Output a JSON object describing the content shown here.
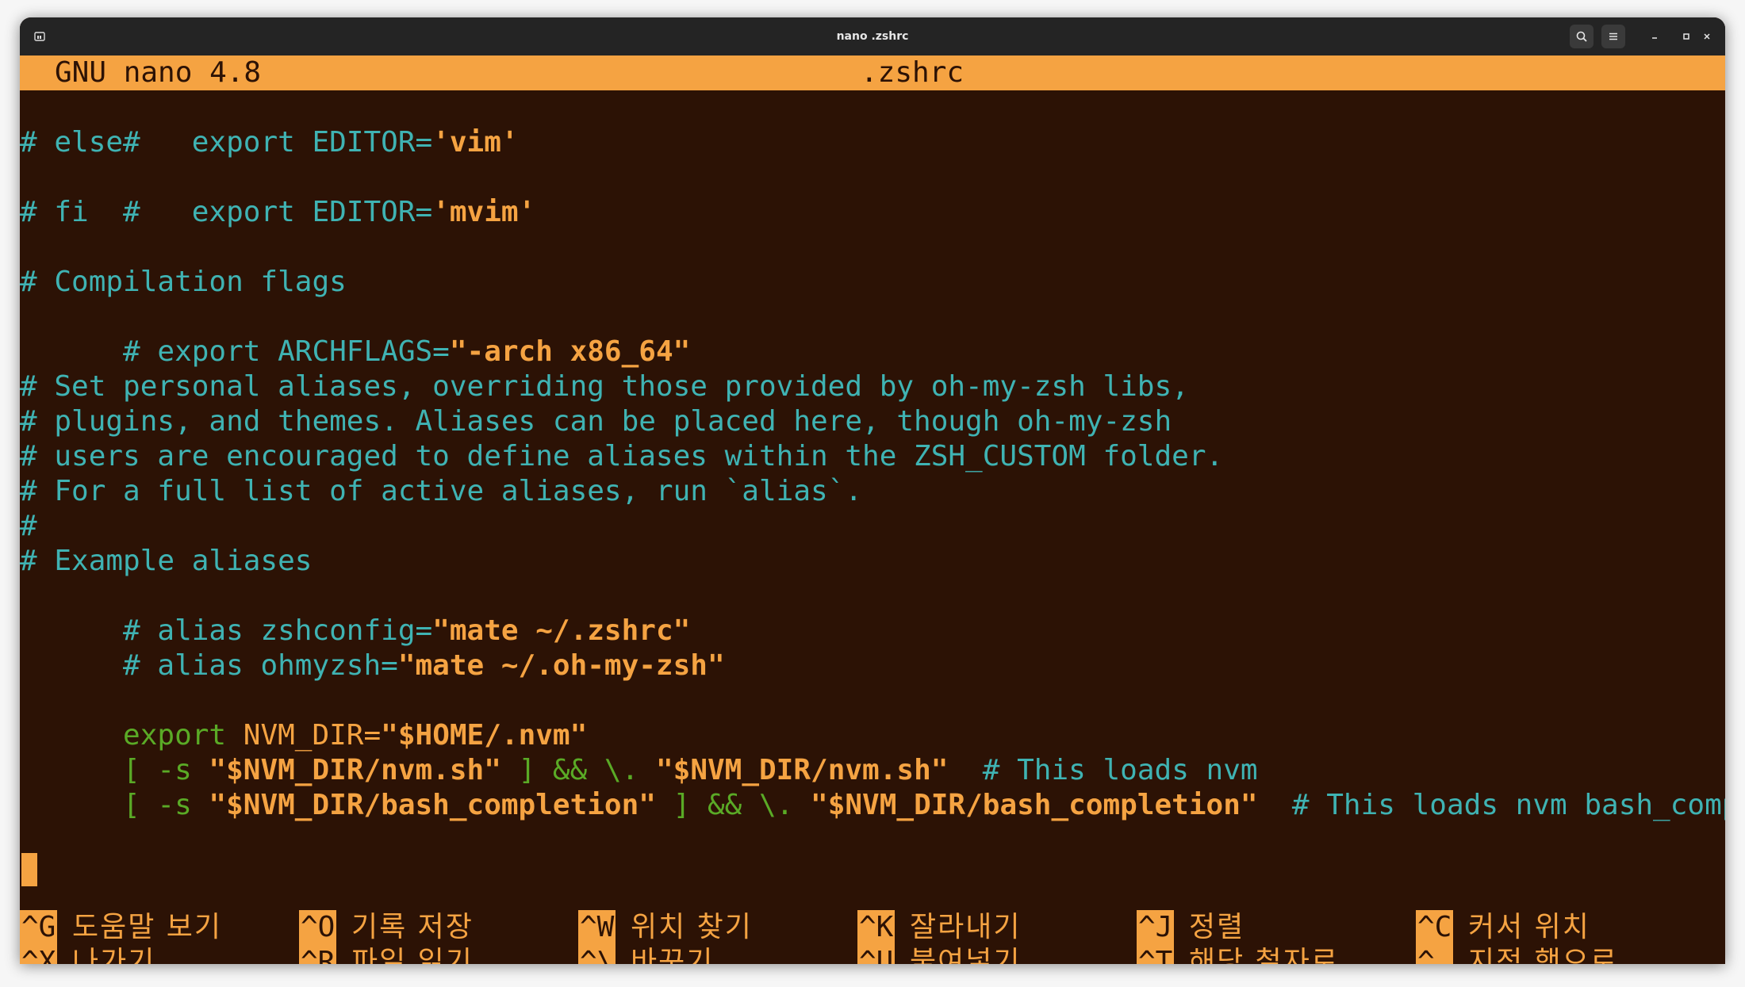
{
  "window": {
    "title": "nano .zshrc",
    "pin_icon": "terminal-pin-icon",
    "search_icon": "search-icon",
    "menu_icon": "hamburger-menu-icon",
    "minimize_icon": "minimize-icon",
    "maximize_icon": "maximize-icon",
    "close_icon": "close-icon"
  },
  "nano": {
    "version": "GNU nano 4.8",
    "filename": ".zshrc"
  },
  "lines": {
    "l1": {
      "prefix": "#   export EDITOR=",
      "str": "'vim'"
    },
    "l2": {
      "text": "# else"
    },
    "l3": {
      "prefix": "#   export EDITOR=",
      "str": "'mvim'"
    },
    "l4": {
      "text": "# fi"
    },
    "l5": {
      "text": ""
    },
    "l6": {
      "text": "# Compilation flags"
    },
    "l7": {
      "prefix": "# export ARCHFLAGS=",
      "str": "\"-arch x86_64\""
    },
    "l8": {
      "text": ""
    },
    "l9": {
      "text": "# Set personal aliases, overriding those provided by oh-my-zsh libs,"
    },
    "l10": {
      "text": "# plugins, and themes. Aliases can be placed here, though oh-my-zsh"
    },
    "l11": {
      "text": "# users are encouraged to define aliases within the ZSH_CUSTOM folder."
    },
    "l12": {
      "text": "# For a full list of active aliases, run `alias`."
    },
    "l13": {
      "text": "#"
    },
    "l14": {
      "text": "# Example aliases"
    },
    "l15": {
      "prefix": "# alias zshconfig=",
      "str": "\"mate ~/.zshrc\""
    },
    "l16": {
      "prefix": "# alias ohmyzsh=",
      "str": "\"mate ~/.oh-my-zsh\""
    },
    "l17": {
      "text": ""
    },
    "l18": {
      "kw": "export",
      "var": " NVM_DIR=",
      "str": "\"$HOME/.nvm\""
    },
    "l19": {
      "b1": "[ -s ",
      "s1": "\"$NVM_DIR/nvm.sh\"",
      "b2": " ] && \\. ",
      "s2": "\"$NVM_DIR/nvm.sh\"",
      "comment": "  # This loads nvm"
    },
    "l20": {
      "b1": "[ -s ",
      "s1": "\"$NVM_DIR/bash_completion\"",
      "b2": " ] && \\. ",
      "s2": "\"$NVM_DIR/bash_completion\"",
      "comment": "  # This loads nvm bash_compl>"
    }
  },
  "shortcuts": {
    "row1": [
      {
        "key": "^G",
        "label": "도움말 보기"
      },
      {
        "key": "^O",
        "label": "기록 저장"
      },
      {
        "key": "^W",
        "label": "위치 찾기"
      },
      {
        "key": "^K",
        "label": "잘라내기"
      },
      {
        "key": "^J",
        "label": "정렬"
      },
      {
        "key": "^C",
        "label": "커서 위치"
      }
    ],
    "row2": [
      {
        "key": "^X",
        "label": "나가기"
      },
      {
        "key": "^R",
        "label": "파일 읽기"
      },
      {
        "key": "^\\",
        "label": "바꾸기"
      },
      {
        "key": "^U",
        "label": "붙여넣기"
      },
      {
        "key": "^T",
        "label": "해당 철자로"
      },
      {
        "key": "^_",
        "label": "지정 행으로"
      }
    ]
  },
  "colors": {
    "background": "#2c1205",
    "comment": "#3fb3b3",
    "string": "#f5a342",
    "keyword": "#5aaa26",
    "header_bg": "#f5a342"
  }
}
